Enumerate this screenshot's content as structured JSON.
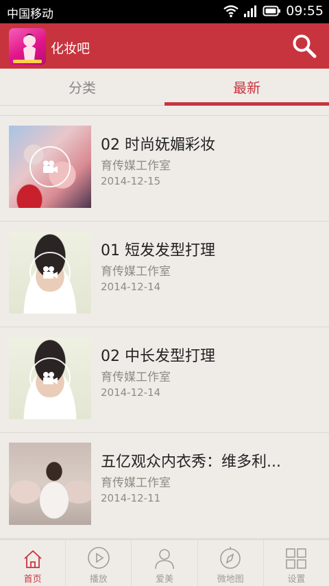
{
  "status_bar": {
    "carrier": "中国移动",
    "time": "09:55"
  },
  "app_bar": {
    "title": "化妆吧",
    "logo_icon": "makeup-logo",
    "search_icon": "search-icon",
    "color": "#c8343e"
  },
  "tabs": [
    {
      "label": "分类",
      "active": false
    },
    {
      "label": "最新",
      "active": true
    }
  ],
  "videos": [
    {
      "title": "02 时尚妩媚彩妆",
      "author": "育传媒工作室",
      "date": "2014-12-15"
    },
    {
      "title": "01 短发发型打理",
      "author": "育传媒工作室",
      "date": "2014-12-14"
    },
    {
      "title": "02 中长发型打理",
      "author": "育传媒工作室",
      "date": "2014-12-14"
    },
    {
      "title": "五亿观众内衣秀：维多利...",
      "author": "育传媒工作室",
      "date": "2014-12-11"
    }
  ],
  "bottom_nav": [
    {
      "label": "首页",
      "icon": "home-icon",
      "active": true
    },
    {
      "label": "播放",
      "icon": "play-icon",
      "active": false
    },
    {
      "label": "爱美",
      "icon": "user-icon",
      "active": false
    },
    {
      "label": "微地图",
      "icon": "compass-icon",
      "active": false
    },
    {
      "label": "设置",
      "icon": "grid-icon",
      "active": false
    }
  ]
}
